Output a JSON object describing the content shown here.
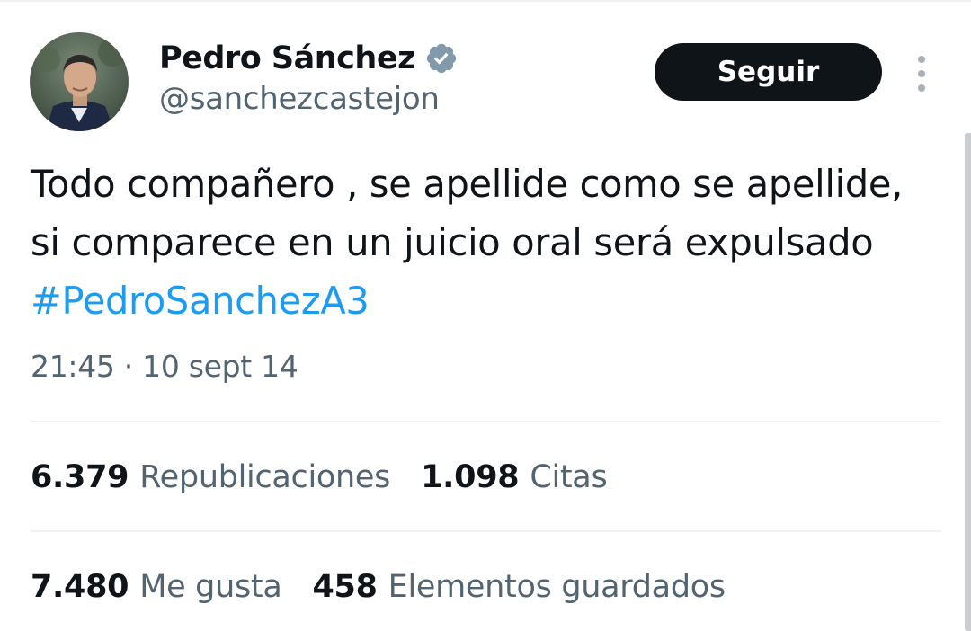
{
  "author": {
    "name": "Pedro Sánchez",
    "handle": "@sanchezcastejon",
    "verified_icon": "verified-badge-icon"
  },
  "actions": {
    "follow_label": "Seguir",
    "more_icon": "more-vertical-icon"
  },
  "tweet": {
    "text": "Todo compañero , se apellide como se apellide, si comparece en un juicio oral será expulsado ",
    "hashtag": "#PedroSanchezA3",
    "timestamp": "21:45 · 10 sept 14"
  },
  "stats": {
    "reposts": {
      "value": "6.379",
      "label": "Republicaciones"
    },
    "quotes": {
      "value": "1.098",
      "label": "Citas"
    },
    "likes": {
      "value": "7.480",
      "label": "Me gusta"
    },
    "bookmarks": {
      "value": "458",
      "label": "Elementos guardados"
    }
  },
  "colors": {
    "text_primary": "#0f1419",
    "text_secondary": "#536471",
    "link": "#1d9bf0",
    "button_bg": "#0f1419",
    "badge": "#829aab"
  }
}
